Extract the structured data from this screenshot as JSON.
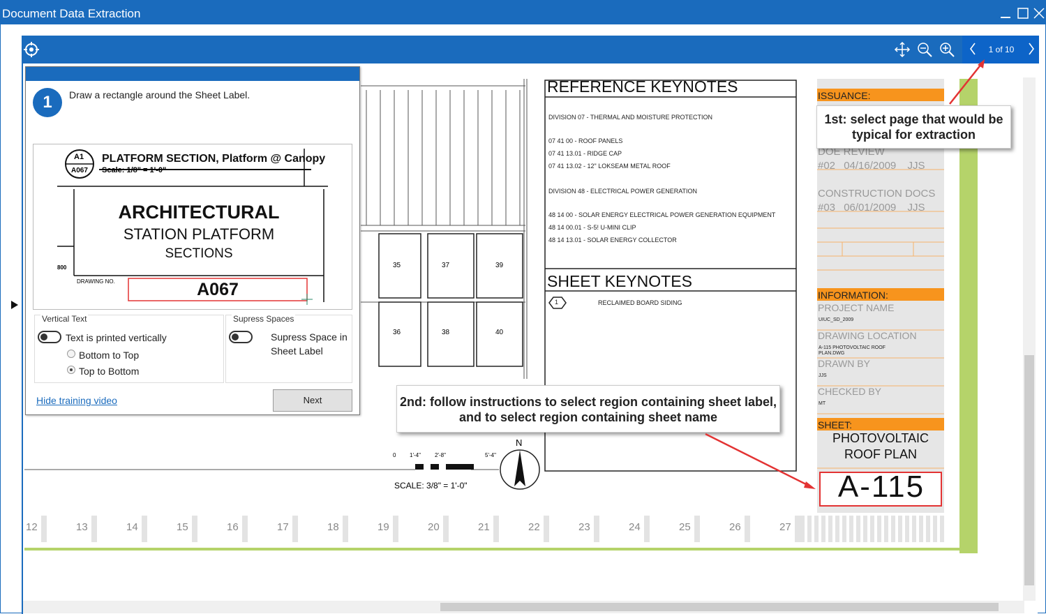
{
  "window": {
    "title": "Document Data Extraction",
    "controls": [
      "minimize-icon",
      "maximize-icon",
      "close-icon"
    ]
  },
  "toolbar": {
    "icons": [
      "target-icon",
      "pan-icon",
      "zoom-out-icon",
      "zoom-in-icon"
    ],
    "pager_text": "1 of 10"
  },
  "drawing": {
    "ref_keynotes_title": "REFERENCE KEYNOTES",
    "ref_lines": [
      "DIVISION 07 - THERMAL AND MOISTURE PROTECTION",
      "07 41 00 - ROOF PANELS",
      "07 41 13.01    -    RIDGE CAP",
      "07 41 13.02    -    12\" LOKSEAM METAL ROOF",
      "DIVISION 48 - ELECTRICAL POWER GENERATION",
      "48 14 00 - SOLAR ENERGY ELECTRICAL POWER GENERATION EQUIPMENT",
      "48 14 00.01    -    S-5! U-MINI CLIP",
      "48 14 13.01    -    SOLAR ENERGY COLLECTOR"
    ],
    "sheet_keynotes_title": "SHEET KEYNOTES",
    "sheet_keynote_num": "1",
    "sheet_keynote_text": "RECLAIMED BOARD SIDING",
    "panel_numbers": [
      "35",
      "37",
      "39",
      "36",
      "38",
      "40"
    ],
    "scale_ticks": [
      "0",
      "1'-4\"",
      "2'-8\"",
      "5'-4\""
    ],
    "scale_text": "SCALE: 3/8\" = 1'-0\"",
    "north": "N",
    "ruler": [
      "12",
      "13",
      "14",
      "15",
      "16",
      "17",
      "18",
      "19",
      "20",
      "21",
      "22",
      "23",
      "24",
      "25",
      "26",
      "27"
    ],
    "title_block": {
      "issuance": "ISSUANCE:",
      "doe_review": "DOE REVIEW",
      "row1": {
        "num": "#02",
        "date": "04/16/2009",
        "by": "JJS"
      },
      "construction": "CONSTRUCTION DOCS",
      "row2": {
        "num": "#03",
        "date": "06/01/2009",
        "by": "JJS"
      },
      "information": "INFORMATION:",
      "project_name_label": "PROJECT NAME",
      "project_name": "UIUC_SD_2009",
      "drawing_location_label": "DRAWING LOCATION",
      "drawing_location": "A-115 PHOTOVOLTAIC ROOF PLAN.DWG",
      "drawn_by_label": "DRAWN BY",
      "drawn_by": "JJS",
      "checked_by_label": "CHECKED BY",
      "checked_by": "MT",
      "sheet_label": "SHEET:",
      "sheet_name": "PHOTOVOLTAIC ROOF PLAN",
      "sheet_number": "A-115"
    }
  },
  "panel": {
    "step_number": "1",
    "step_text": "Draw a rectangle around the Sheet Label.",
    "preview": {
      "detail_num": "A1",
      "detail_sheet": "A067",
      "section_title": "PLATFORM SECTION, Platform @ Canopy",
      "scale": "Scale: 1/8\" = 1'-0\"",
      "line1": "ARCHITECTURAL",
      "line2": "STATION PLATFORM",
      "line3": "SECTIONS",
      "side_num": "800",
      "drawing_no_label": "DRAWING NO.",
      "drawing_no": "A067"
    },
    "vertical_text_label": "Vertical Text",
    "vertical_toggle_text": "Text is printed vertically",
    "radio_bottom_top": "Bottom to Top",
    "radio_top_bottom": "Top to Bottom",
    "supress_label": "Supress Spaces",
    "supress_toggle_text": "Supress Space in Sheet Label",
    "hide_video_link": "Hide training video",
    "next_button": "Next"
  },
  "callouts": {
    "first": "1st: select page that would be typical for extraction",
    "second": "2nd: follow instructions to select region containing sheet label, and to select region containing sheet name"
  },
  "colors": {
    "accent": "#1a6bbd",
    "orange": "#f7941d",
    "green": "#b5d36a",
    "red": "#e33333"
  }
}
